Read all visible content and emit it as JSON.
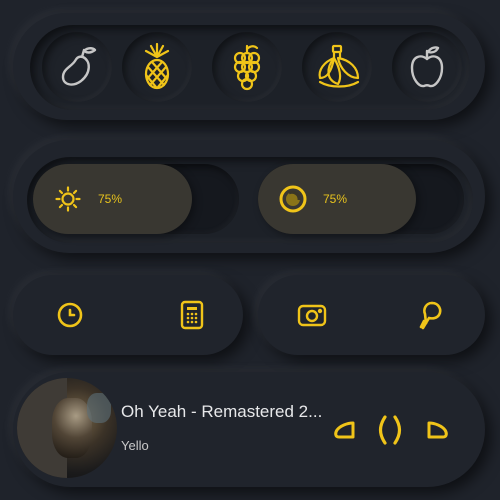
{
  "fruits": [
    {
      "name": "mango",
      "icon": "mango-icon",
      "color": "#c6c6c6"
    },
    {
      "name": "pineapple",
      "icon": "pineapple-icon",
      "color": "#f0c419"
    },
    {
      "name": "grapes",
      "icon": "grapes-icon",
      "color": "#f0c419"
    },
    {
      "name": "banana",
      "icon": "banana-icon",
      "color": "#f0c419"
    },
    {
      "name": "apple",
      "icon": "apple-icon",
      "color": "#c6c6c6"
    }
  ],
  "sliders": {
    "brightness": {
      "label": "75%",
      "icon": "sun-icon",
      "level": 0.75
    },
    "volume": {
      "label": "75%",
      "icon": "dial-icon",
      "level": 0.75
    }
  },
  "shortcuts": [
    {
      "name": "clock",
      "icon": "clock-icon"
    },
    {
      "name": "calculator",
      "icon": "calculator-icon"
    },
    {
      "name": "camera",
      "icon": "camera-icon"
    },
    {
      "name": "food",
      "icon": "drumstick-icon"
    }
  ],
  "media": {
    "title": "Oh Yeah - Remastered 2...",
    "artist": "Yello",
    "controls": [
      "previous-icon",
      "pause-icon",
      "next-icon"
    ]
  },
  "colors": {
    "accent": "#f0c419",
    "inactive": "#c6c6c6",
    "background": "#1f232b"
  }
}
